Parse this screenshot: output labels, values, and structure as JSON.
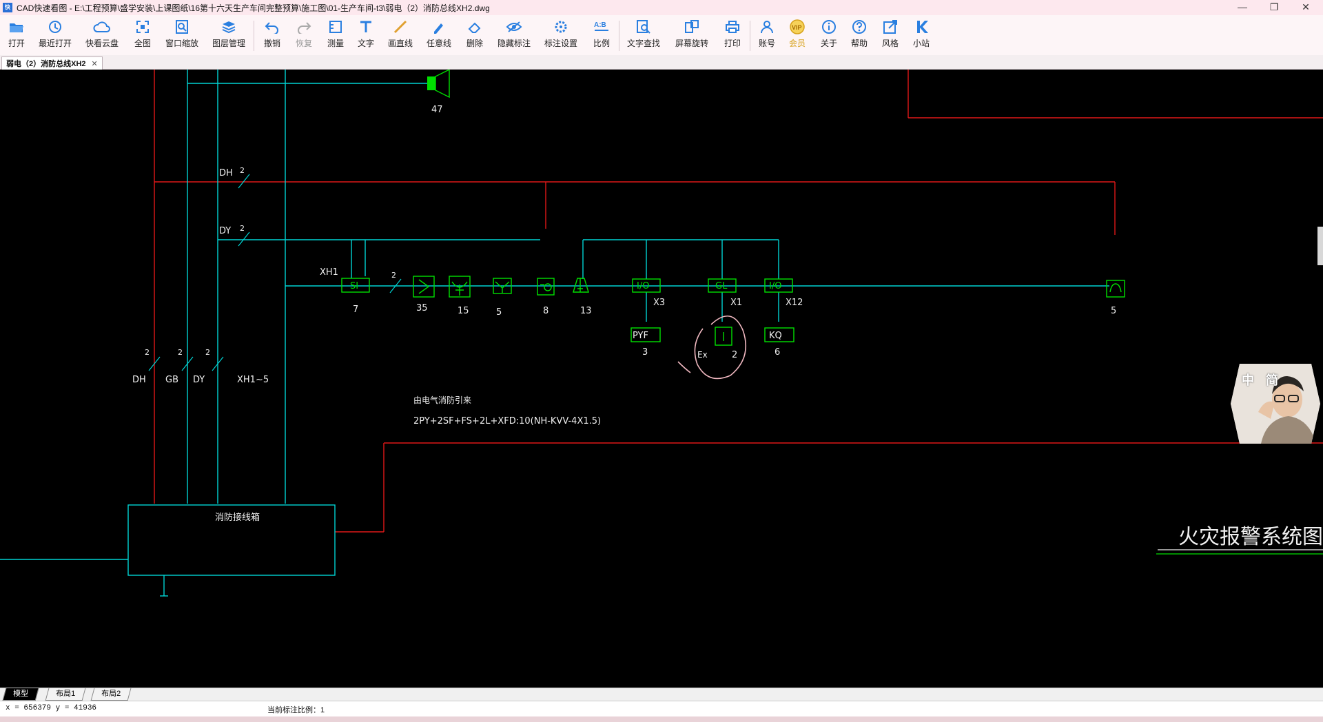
{
  "window": {
    "app_icon_text": "快",
    "title": "CAD快速看图 - E:\\工程预算\\盛学安装\\上课图纸\\16第十六天生产车间完整预算\\施工图\\01-生产车间-t3\\弱电（2）消防总线XH2.dwg",
    "min": "—",
    "max": "❐",
    "close": "✕"
  },
  "toolbar": {
    "items": [
      {
        "label": "打开",
        "icon": "folder-open-icon"
      },
      {
        "label": "最近打开",
        "icon": "history-icon"
      },
      {
        "label": "快看云盘",
        "icon": "cloud-icon"
      },
      {
        "label": "全图",
        "icon": "fit-all-icon"
      },
      {
        "label": "窗口缩放",
        "icon": "zoom-window-icon"
      },
      {
        "label": "图层管理",
        "icon": "layers-icon"
      },
      {
        "label": "撤销",
        "icon": "undo-icon"
      },
      {
        "label": "恢复",
        "icon": "redo-icon"
      },
      {
        "label": "测量",
        "icon": "measure-icon"
      },
      {
        "label": "文字",
        "icon": "text-icon"
      },
      {
        "label": "画直线",
        "icon": "line-icon"
      },
      {
        "label": "任意线",
        "icon": "freehand-icon"
      },
      {
        "label": "删除",
        "icon": "eraser-icon"
      },
      {
        "label": "隐藏标注",
        "icon": "hide-annotation-icon"
      },
      {
        "label": "标注设置",
        "icon": "annotation-settings-icon"
      },
      {
        "label": "比例",
        "icon": "scale-icon"
      },
      {
        "label": "文字查找",
        "icon": "text-search-icon"
      },
      {
        "label": "屏幕旋转",
        "icon": "rotate-screen-icon"
      },
      {
        "label": "打印",
        "icon": "print-icon"
      },
      {
        "label": "账号",
        "icon": "account-icon"
      },
      {
        "label": "会员",
        "icon": "vip-icon"
      },
      {
        "label": "关于",
        "icon": "info-icon"
      },
      {
        "label": "帮助",
        "icon": "help-icon"
      },
      {
        "label": "风格",
        "icon": "style-icon"
      },
      {
        "label": "小站",
        "icon": "station-icon"
      }
    ],
    "scale_icon_text": "A:B",
    "vip_icon_text": "VIP"
  },
  "document_tab": {
    "label": "弱电（2）消防总线XH2",
    "close": "✕"
  },
  "drawing": {
    "labels": {
      "speaker_count": "47",
      "dh": "DH",
      "dy": "DY",
      "gb": "GB",
      "xh1": "XH1",
      "xh1_5": "XH1~5",
      "two": "2",
      "si": "SI",
      "io": "I/O",
      "gl": "GL",
      "pyf": "PYF",
      "kq": "KQ",
      "x3": "X3",
      "x1": "X1",
      "x12": "X12",
      "ex": "Ex",
      "c7": "7",
      "c35": "35",
      "c15": "15",
      "c5": "5",
      "c8": "8",
      "c13": "13",
      "c3": "3",
      "c2": "2",
      "c6": "6",
      "c5b": "5",
      "note1": "由电气消防引来",
      "note2": "2PY+2SF+FS+2L+XFD:10(NH-KVV-4X1.5)",
      "box": "消防接线箱",
      "system_title": "火灾报警系统图"
    },
    "colors": {
      "cyan": "#00d4d4",
      "red": "#e01818",
      "green": "#00e000",
      "white": "#f0f0f0",
      "pink": "#f0b8c0"
    }
  },
  "layout_tabs": [
    "模型",
    "布局1",
    "布局2"
  ],
  "status": {
    "coords": "x = 656379  y = 41936",
    "scale": "当前标注比例：1"
  },
  "webcam": {
    "label": "中 简"
  }
}
